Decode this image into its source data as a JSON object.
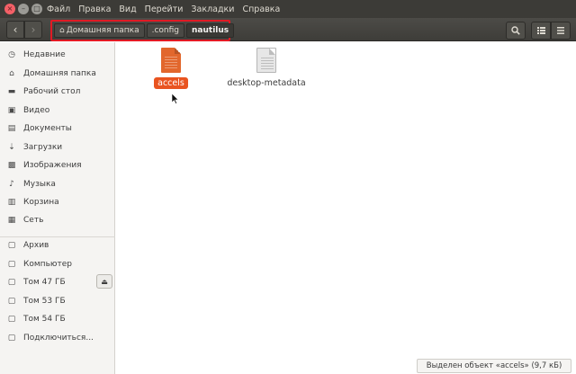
{
  "menubar": {
    "items": [
      "Файл",
      "Правка",
      "Вид",
      "Перейти",
      "Закладки",
      "Справка"
    ]
  },
  "toolbar": {
    "breadcrumbs": [
      "Домашняя папка",
      ".config",
      "nautilus"
    ]
  },
  "sidebar": {
    "places": [
      {
        "label": "Недавние",
        "icon": "recent-icon"
      },
      {
        "label": "Домашняя папка",
        "icon": "home-icon"
      },
      {
        "label": "Рабочий стол",
        "icon": "desktop-icon"
      },
      {
        "label": "Видео",
        "icon": "video-icon"
      },
      {
        "label": "Документы",
        "icon": "documents-icon"
      },
      {
        "label": "Загрузки",
        "icon": "downloads-icon"
      },
      {
        "label": "Изображения",
        "icon": "pictures-icon"
      },
      {
        "label": "Музыка",
        "icon": "music-icon"
      },
      {
        "label": "Корзина",
        "icon": "trash-icon"
      },
      {
        "label": "Сеть",
        "icon": "network-icon"
      }
    ],
    "devices": [
      {
        "label": "Архив",
        "icon": "drive-icon"
      },
      {
        "label": "Компьютер",
        "icon": "drive-icon"
      },
      {
        "label": "Том 47 ГБ",
        "icon": "drive-icon"
      },
      {
        "label": "Том 53 ГБ",
        "icon": "drive-icon"
      },
      {
        "label": "Том 54 ГБ",
        "icon": "drive-icon"
      },
      {
        "label": "Подключиться...",
        "icon": "connect-icon"
      }
    ]
  },
  "files": [
    {
      "name": "accels",
      "selected": true
    },
    {
      "name": "desktop-metadata",
      "selected": false
    }
  ],
  "status": {
    "text": "Выделен объект «accels» (9,7 кБ)"
  },
  "colors": {
    "accent": "#e95420",
    "highlight_border": "#e11a24",
    "menubar_bg": "#3c3b37"
  }
}
